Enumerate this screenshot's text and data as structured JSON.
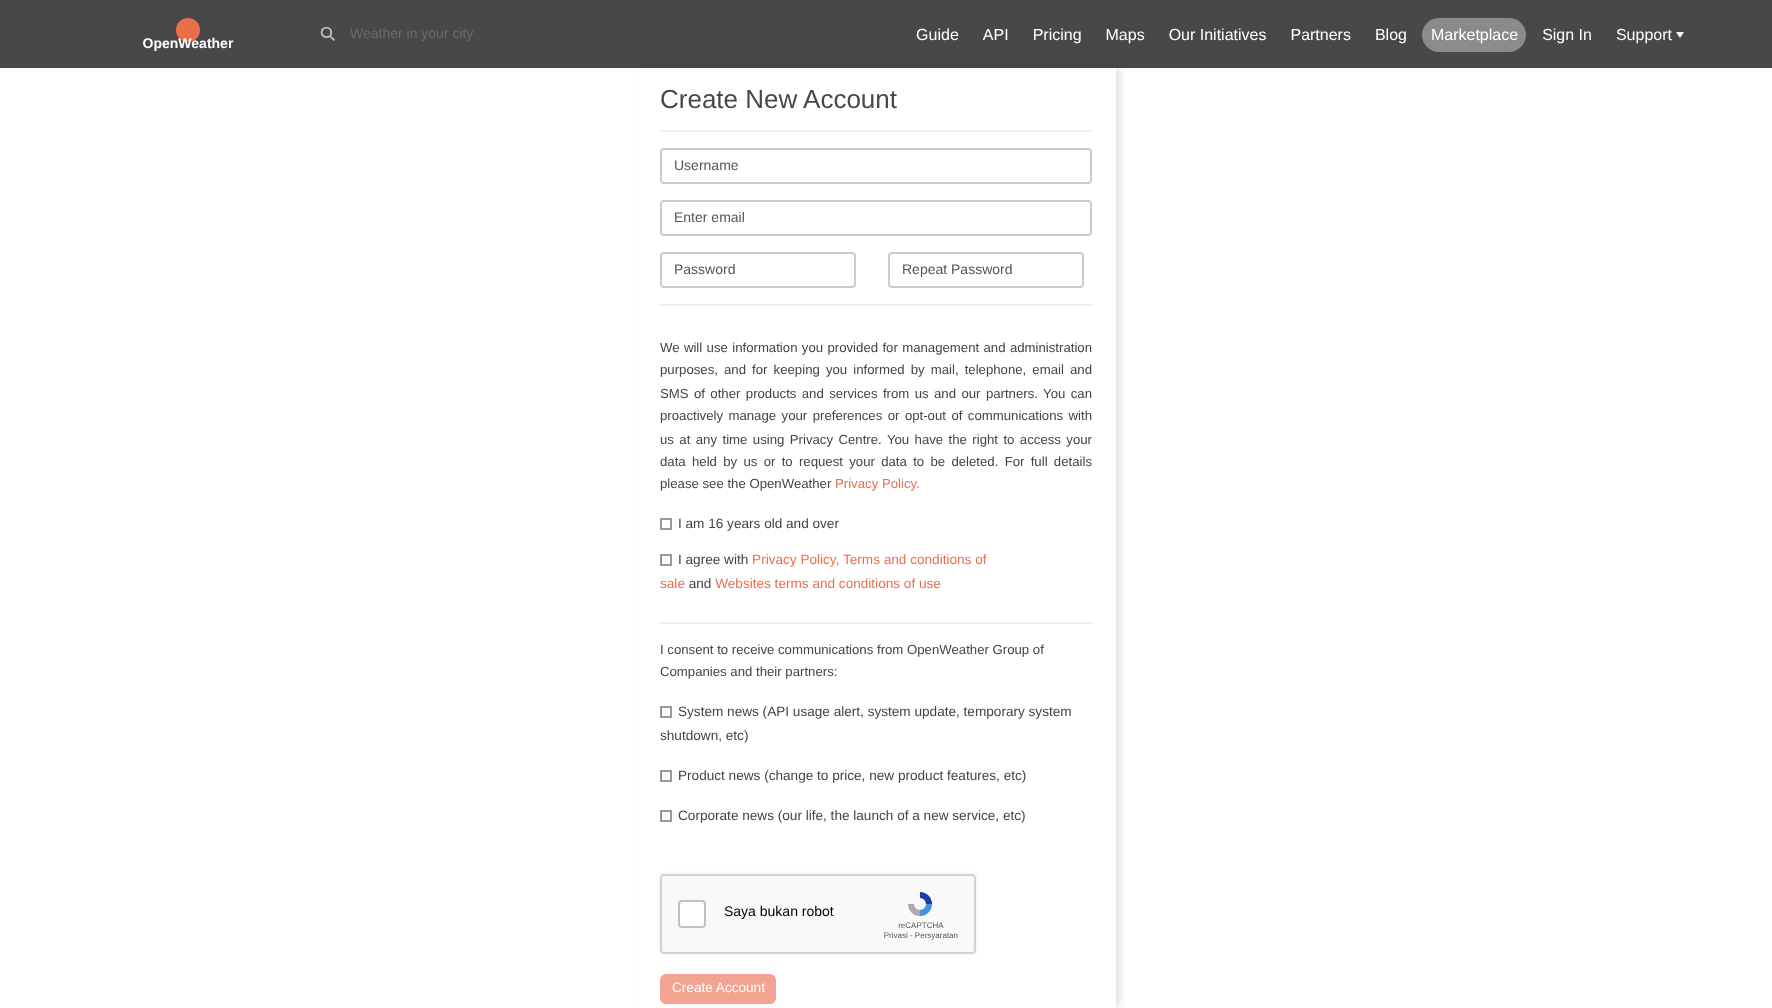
{
  "nav": {
    "logo": "OpenWeather",
    "search": {
      "placeholder": "Weather in your city"
    },
    "links": [
      {
        "label": "Guide",
        "selected": false
      },
      {
        "label": "API",
        "selected": false
      },
      {
        "label": "Pricing",
        "selected": false
      },
      {
        "label": "Maps",
        "selected": false
      },
      {
        "label": "Our Initiatives",
        "selected": false
      },
      {
        "label": "Partners",
        "selected": false
      },
      {
        "label": "Blog",
        "selected": false
      },
      {
        "label": "Marketplace",
        "selected": true
      },
      {
        "label": "Sign In",
        "selected": false
      },
      {
        "label": "Support",
        "selected": false,
        "dropdown": true
      }
    ]
  },
  "form": {
    "title": "Create New Account",
    "fields": [
      {
        "placeholder": "Username",
        "kind": "full"
      },
      {
        "placeholder": "Enter email",
        "kind": "full"
      },
      {
        "placeholder": "Password",
        "kind": "half"
      },
      {
        "placeholder": "Repeat Password",
        "kind": "half"
      }
    ],
    "notice": "We will use information you provided for management and administration purposes, and for keeping you informed by mail, telephone, email and SMS of other products and services from us and our partners. You can proactively manage your preferences or opt-out of communications with us at any time using Privacy Centre. You have the right to access your data held by us or to request your data to be deleted. For full details please see the OpenWeather",
    "notice_link": "Privacy Policy.",
    "age": {
      "label": "I am 16 years old and over",
      "checked": false
    },
    "agree": {
      "checked": false,
      "parts": [
        {
          "text": "I agree with ",
          "link": false
        },
        {
          "text": "Privacy Policy, Terms and conditions of sale",
          "link": true
        },
        {
          "text": " and ",
          "link": false
        },
        {
          "text": "Websites terms and conditions of use",
          "link": true
        }
      ]
    },
    "consent": "I consent to receive communications from OpenWeather Group of Companies and their partners:",
    "options": [
      {
        "label": "System news (API usage alert, system update, temporary system shutdown, etc)",
        "checked": false
      },
      {
        "label": "Product news (change to price, new product features, etc)",
        "checked": false
      },
      {
        "label": "Corporate news (our life, the launch of a new service, etc)",
        "checked": false
      }
    ],
    "captcha": {
      "label": "Saya bukan robot",
      "checked": false,
      "brand": "reCAPTCHA",
      "links": "Privasi - Persyaratan"
    },
    "submit": {
      "label": "Create Account",
      "disabled": true
    }
  }
}
